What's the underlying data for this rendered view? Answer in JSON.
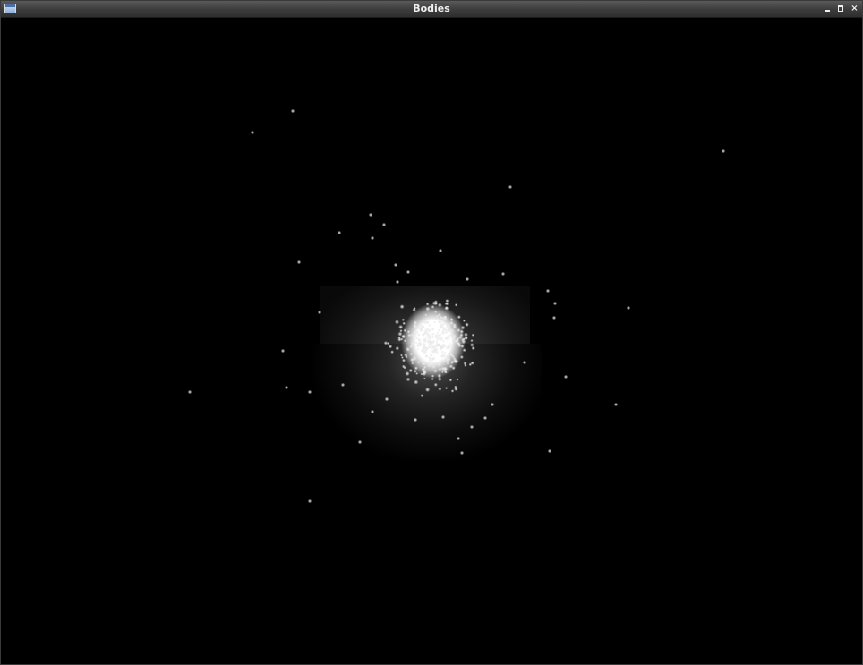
{
  "window": {
    "title": "Bodies",
    "controls": {
      "minimize_icon": "minimize-icon",
      "maximize_icon": "maximize-icon",
      "close_icon": "close-icon",
      "close_glyph": "×"
    },
    "app_icon": "window-icon"
  },
  "scene": {
    "background_color": "#000000",
    "particle_color": "#ffffff",
    "core_color": "#ffffff"
  }
}
